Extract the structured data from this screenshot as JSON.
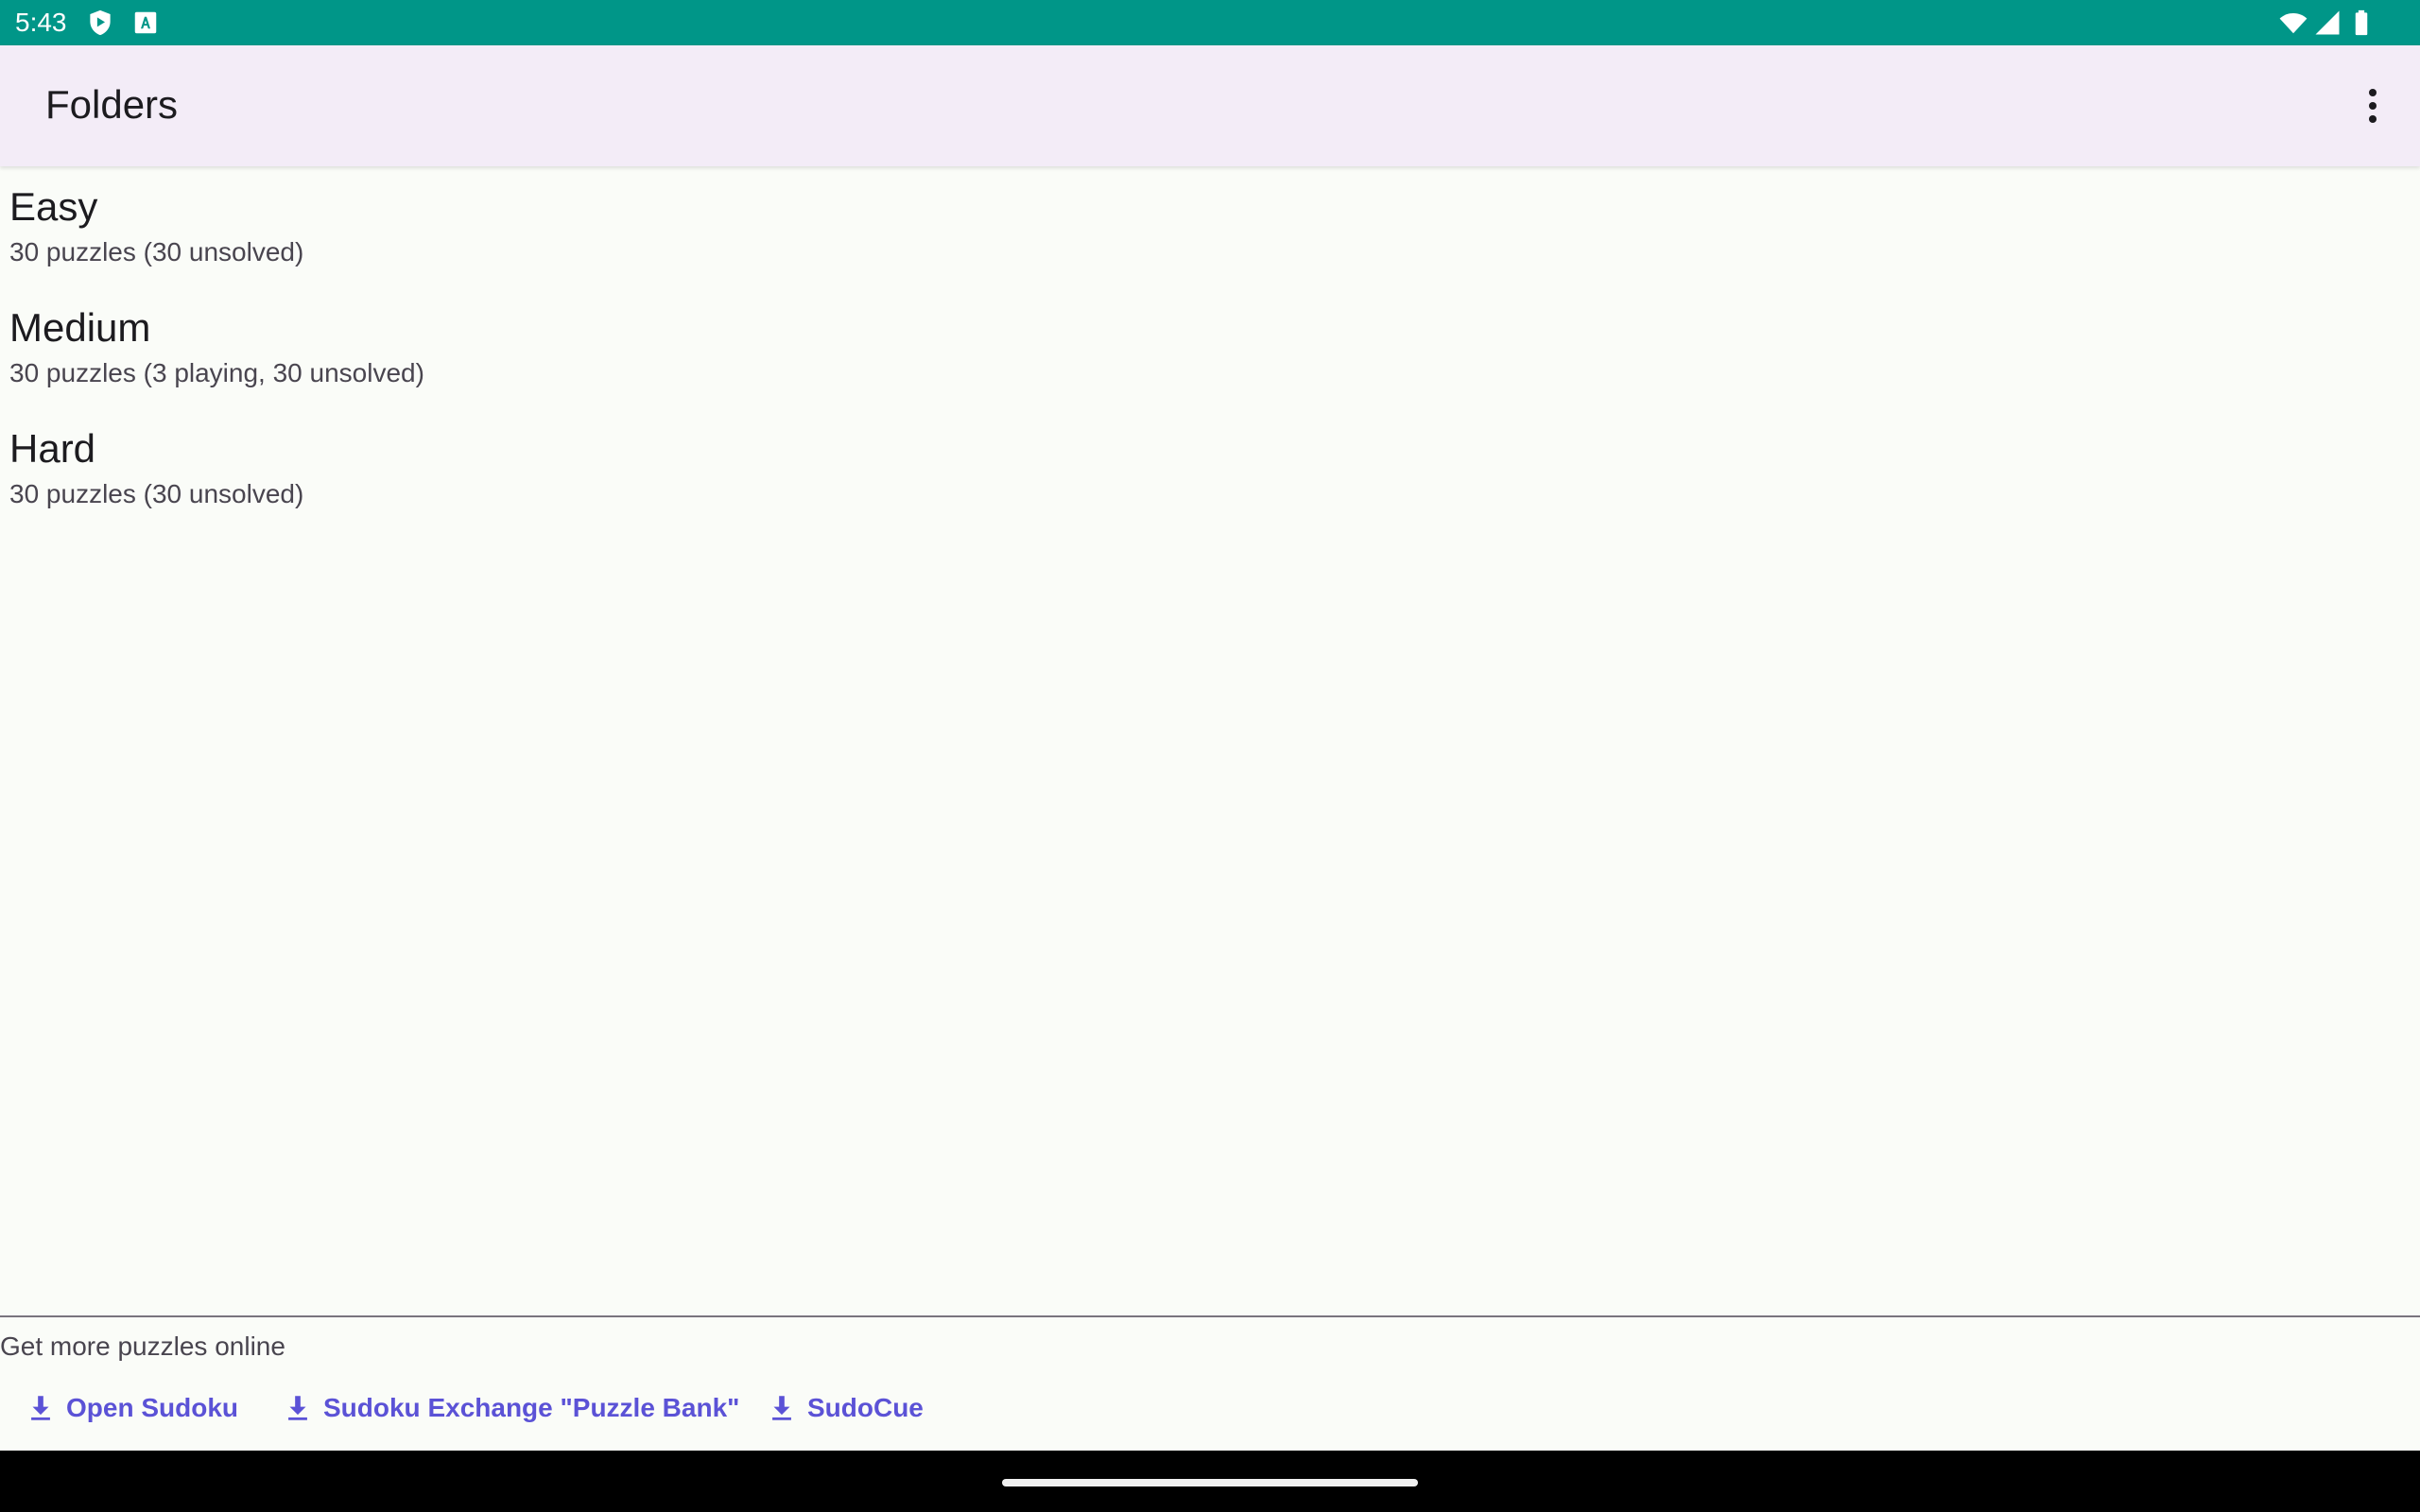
{
  "status_bar": {
    "time": "5:43",
    "left_icons": [
      "play-protect-icon",
      "keyboard-a-icon"
    ],
    "right_icons": [
      "wifi-icon",
      "cell-signal-icon",
      "battery-icon"
    ],
    "background_color": "#009688"
  },
  "app_bar": {
    "title": "Folders",
    "overflow_icon": "more-vert-icon"
  },
  "folders": [
    {
      "name": "Easy",
      "detail": "30 puzzles (30 unsolved)"
    },
    {
      "name": "Medium",
      "detail": "30 puzzles (3 playing, 30 unsolved)"
    },
    {
      "name": "Hard",
      "detail": "30 puzzles (30 unsolved)"
    }
  ],
  "footer": {
    "heading": "Get more puzzles online",
    "links": [
      {
        "label": "Open Sudoku",
        "icon": "download-icon"
      },
      {
        "label": "Sudoku Exchange \"Puzzle Bank\"",
        "icon": "download-icon"
      },
      {
        "label": "SudoCue",
        "icon": "download-icon"
      }
    ],
    "link_color": "#5b52d6"
  }
}
